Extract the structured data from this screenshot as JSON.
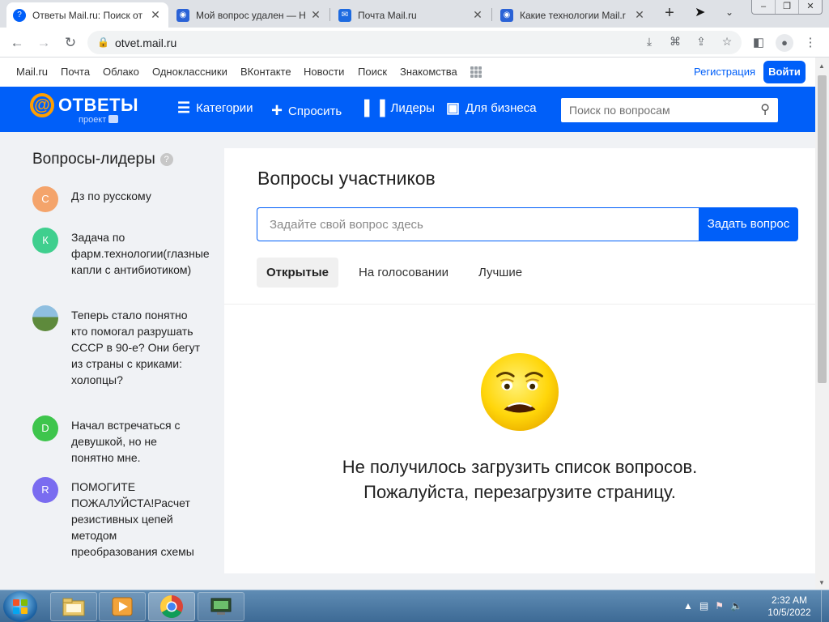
{
  "browser": {
    "tabs": [
      {
        "title": "Ответы Mail.ru: Поиск от",
        "active": true,
        "favicon": "otvety-question-icon"
      },
      {
        "title": "Мой вопрос удален — Н",
        "active": false,
        "favicon": "otvety-icon"
      },
      {
        "title": "Почта Mail.ru",
        "active": false,
        "favicon": "mail-envelope-icon"
      },
      {
        "title": "Какие технологии Mail.r",
        "active": false,
        "favicon": "otvety-icon"
      }
    ],
    "url": "otvet.mail.ru"
  },
  "portal": {
    "links": [
      "Mail.ru",
      "Почта",
      "Облако",
      "Одноклассники",
      "ВКонтакте",
      "Новости",
      "Поиск",
      "Знакомства"
    ],
    "register": "Регистрация",
    "login": "Войти"
  },
  "header": {
    "logo": "ОТВЕТЫ",
    "logo_sub": "проект",
    "nav": [
      "Категории",
      "Спросить",
      "Лидеры",
      "Для бизнеса"
    ],
    "search_placeholder": "Поиск по вопросам"
  },
  "sidebar": {
    "title": "Вопросы-лидеры",
    "help": "?",
    "items": [
      {
        "avatar": "С",
        "color": "#f4a46b",
        "text": "Дз по русскому"
      },
      {
        "avatar": "К",
        "color": "#3fcf8e",
        "text": "Задача по фарм.технологии(глазные капли с антибиотиком)"
      },
      {
        "avatar": "",
        "color": "#6a9a4a",
        "text": "Теперь стало понятно кто помогал разрушать СССР в 90-е? Они бегут из страны с криками: холопцы?"
      },
      {
        "avatar": "D",
        "color": "#3ec54c",
        "text": "Начал встречаться с девушкой, но не понятно мне."
      },
      {
        "avatar": "R",
        "color": "#7a6cf0",
        "text": "ПОМОГИТЕ ПОЖАЛУЙСТА!Расчет резистивных цепей методом преобразования схемы"
      }
    ]
  },
  "main": {
    "title": "Вопросы участников",
    "ask_placeholder": "Задайте свой вопрос здесь",
    "ask_button": "Задать вопрос",
    "tabs": [
      "Открытые",
      "На голосовании",
      "Лучшие"
    ],
    "active_tab": "Открытые",
    "error_line1": "Не получилось загрузить список вопросов.",
    "error_line2": "Пожалуйста, перезагрузите страницу."
  },
  "taskbar": {
    "time": "2:32 AM",
    "date": "10/5/2022"
  },
  "colors": {
    "brand_blue": "#005ff9",
    "logo_orange": "#ff9e00"
  }
}
